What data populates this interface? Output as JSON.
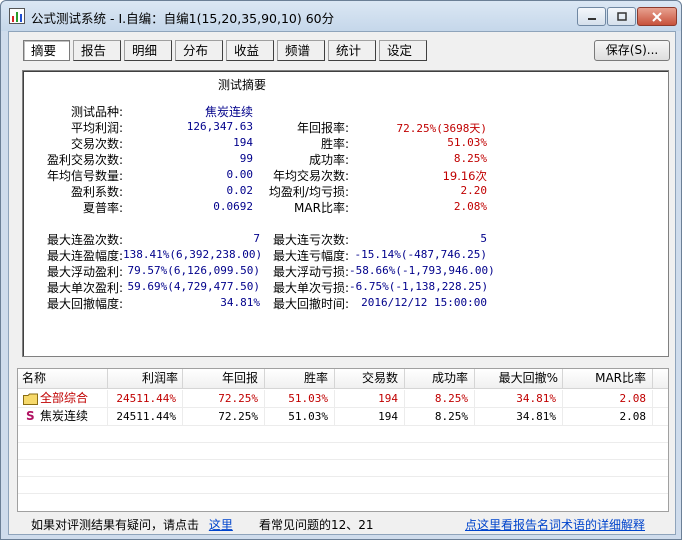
{
  "window": {
    "title": "公式测试系统 - I.自编：自编1(15,20,35,90,10) 60分"
  },
  "tabs": [
    "摘要",
    "报告",
    "明细",
    "分布",
    "收益",
    "频谱",
    "统计",
    "设定"
  ],
  "save_button": "保存(S)...",
  "summary": {
    "title": "测试摘要",
    "left": [
      {
        "label": "测试品种:",
        "value": "焦炭连续"
      },
      {
        "label": "平均利润:",
        "value": "126,347.63"
      },
      {
        "label": "交易次数:",
        "value": "194"
      },
      {
        "label": "盈利交易次数:",
        "value": "99"
      },
      {
        "label": "年均信号数量:",
        "value": "0.00"
      },
      {
        "label": "盈利系数:",
        "value": "0.02"
      },
      {
        "label": "夏普率:",
        "value": "0.0692"
      }
    ],
    "right": [
      {
        "label": "年回报率:",
        "value": "72.25%(3698天)"
      },
      {
        "label": "胜率:",
        "value": "51.03%"
      },
      {
        "label": "成功率:",
        "value": "8.25%"
      },
      {
        "label": "年均交易次数:",
        "value": "19.16次"
      },
      {
        "label": "均盈利/均亏损:",
        "value": "2.20"
      },
      {
        "label": "MAR比率:",
        "value": "2.08%"
      }
    ],
    "lower_left": [
      {
        "label": "最大连盈次数:",
        "value": "7"
      },
      {
        "label": "最大连盈幅度:",
        "value": "138.41%(6,392,238.00)"
      },
      {
        "label": "最大浮动盈利:",
        "value": "79.57%(6,126,099.50)"
      },
      {
        "label": "最大单次盈利:",
        "value": "59.69%(4,729,477.50)"
      },
      {
        "label": "最大回撤幅度:",
        "value": "34.81%"
      }
    ],
    "lower_right": [
      {
        "label": "最大连亏次数:",
        "value": "5"
      },
      {
        "label": "最大连亏幅度:",
        "value": "-15.14%(-487,746.25)"
      },
      {
        "label": "最大浮动亏损:",
        "value": "-58.66%(-1,793,946.00)"
      },
      {
        "label": "最大单次亏损:",
        "value": "-6.75%(-1,138,228.25)"
      },
      {
        "label": "最大回撤时间:",
        "value": "2016/12/12 15:00:00"
      }
    ]
  },
  "table": {
    "headers": [
      "名称",
      "利润率",
      "年回报",
      "胜率",
      "交易数",
      "成功率",
      "最大回撤%",
      "MAR比率"
    ],
    "rows": [
      {
        "name": "全部综合",
        "icon": "folder-icon",
        "cells": [
          "24511.44%",
          "72.25%",
          "51.03%",
          "194",
          "8.25%",
          "34.81%",
          "2.08"
        ],
        "color": "#c00000"
      },
      {
        "name": "焦炭连续",
        "icon": "s-icon",
        "cells": [
          "24511.44%",
          "72.25%",
          "51.03%",
          "194",
          "8.25%",
          "34.81%",
          "2.08"
        ],
        "color": "#000000"
      }
    ]
  },
  "footer": {
    "question_text": "如果对评测结果有疑问，请点击",
    "here_link": "这里",
    "faq_text": "看常见问题的12、21",
    "detail_link": "点这里看报告名词术语的详细解释"
  },
  "colors": {
    "label_blue": "#00008b",
    "value_red": "#c00000",
    "link": "#0044cc"
  }
}
